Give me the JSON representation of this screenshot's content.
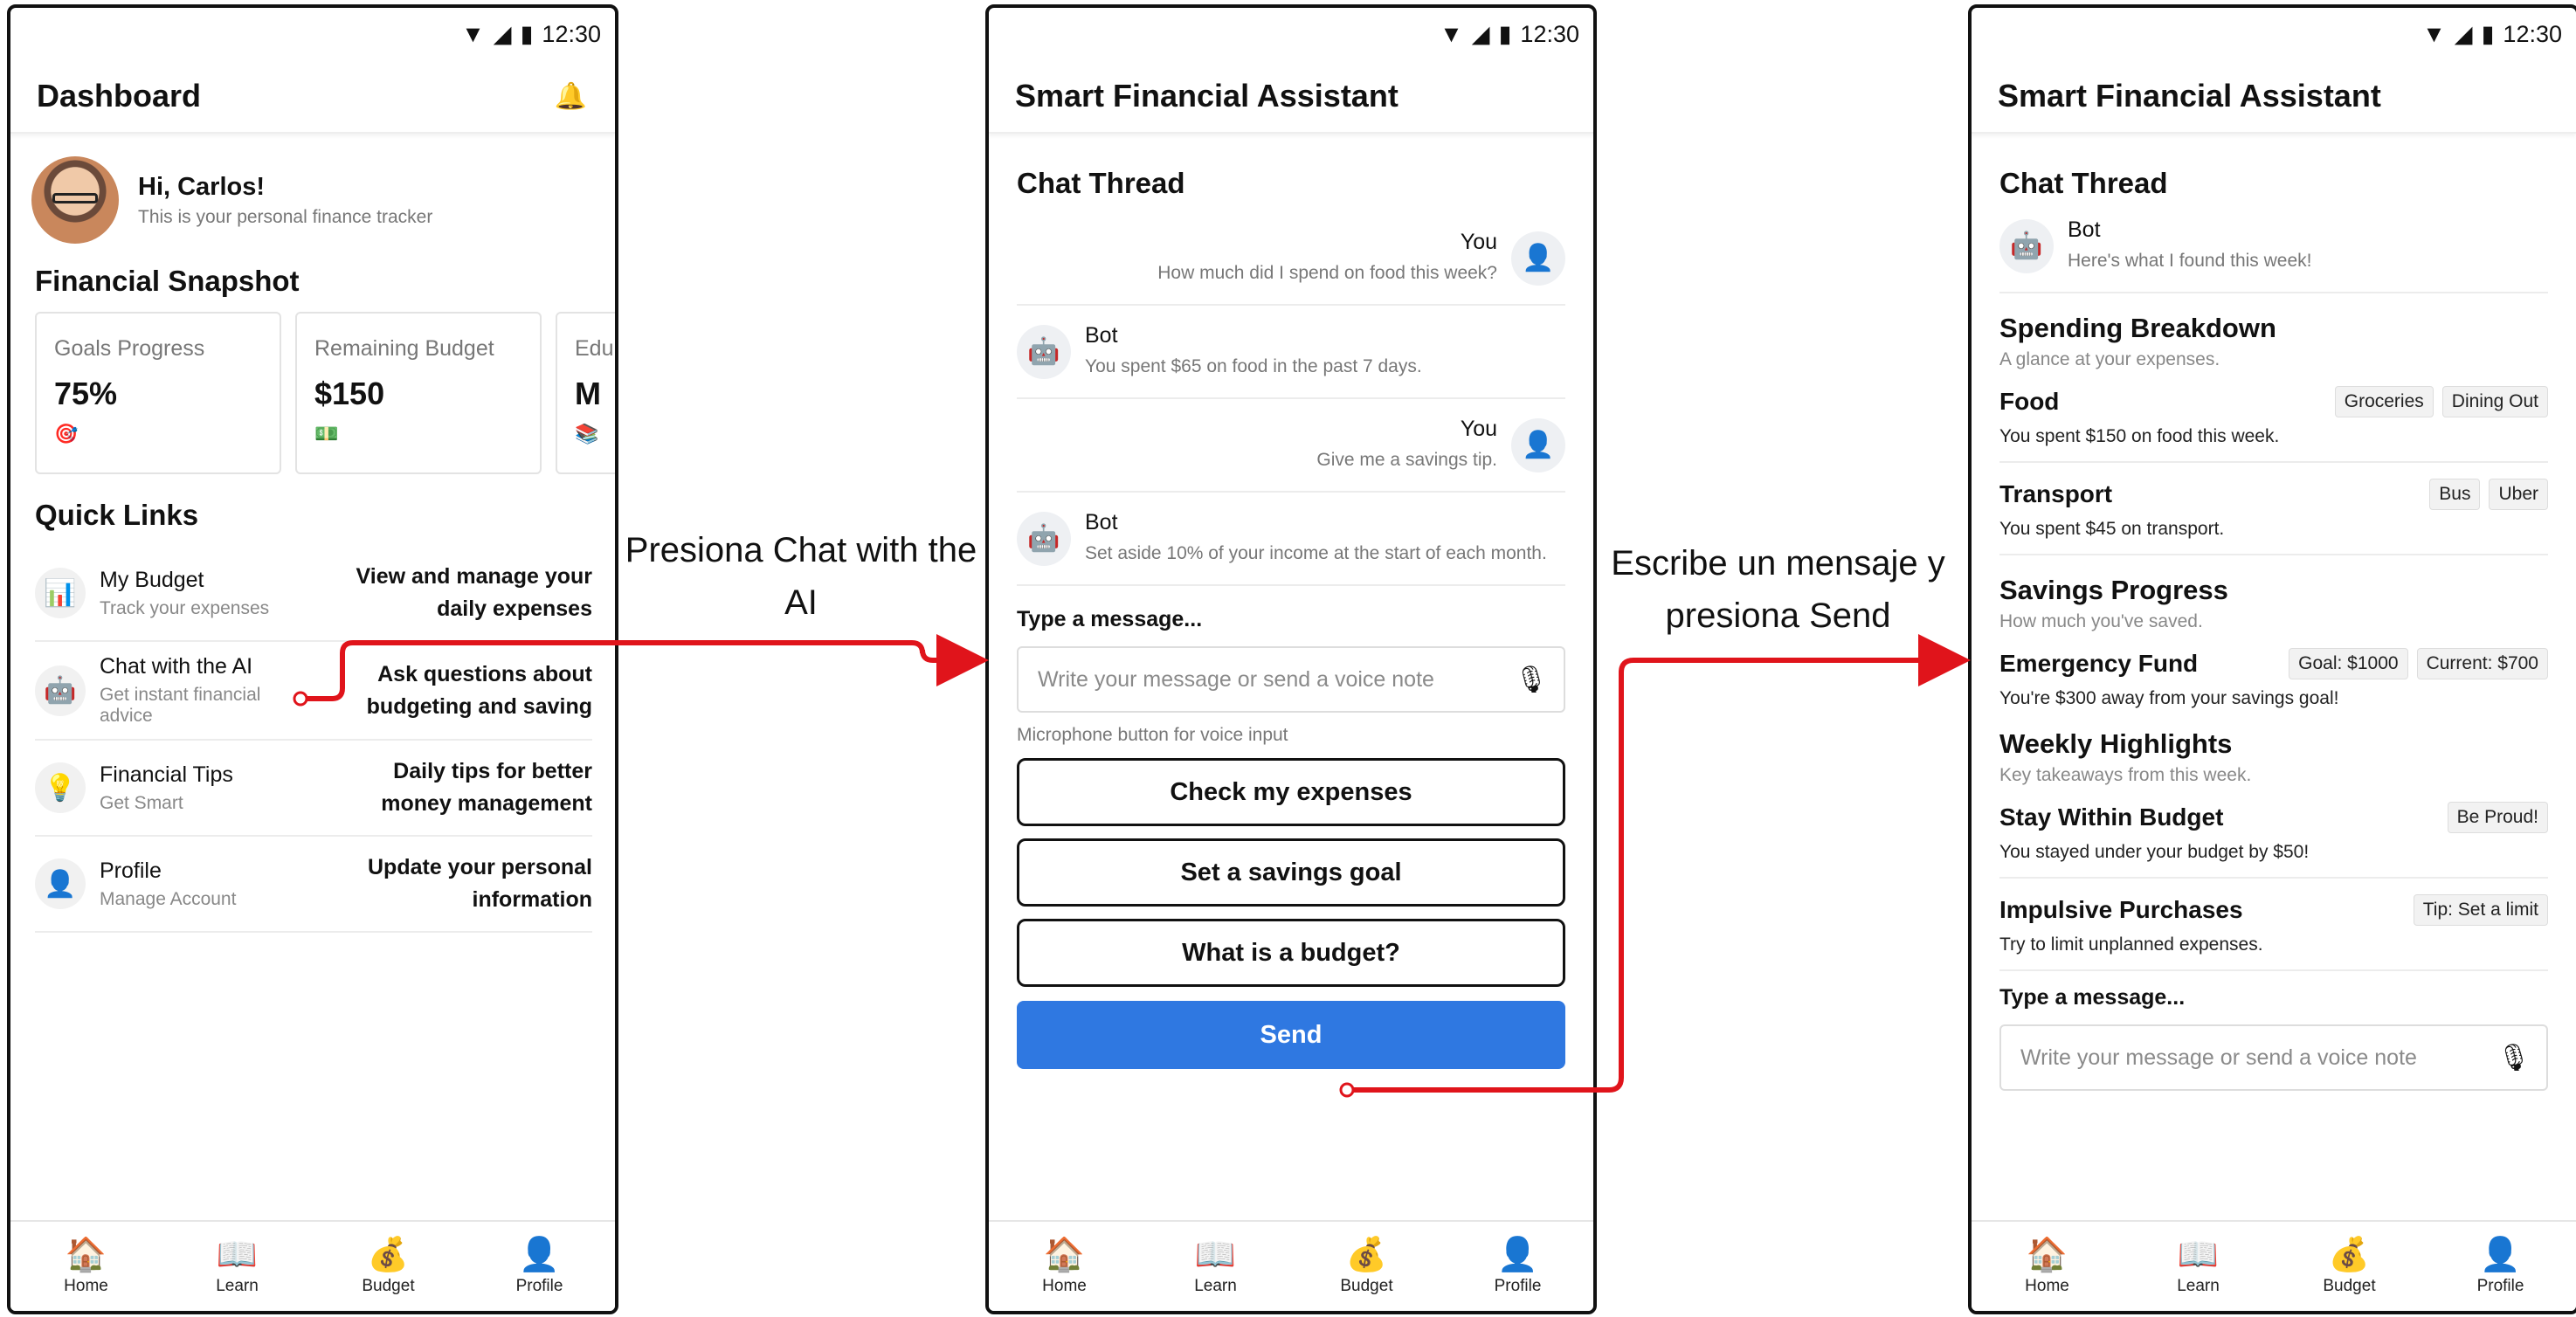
{
  "status_bar": {
    "time": "12:30"
  },
  "screen1": {
    "title": "Dashboard",
    "greeting": "Hi, Carlos!",
    "greeting_sub": "This is your personal finance tracker",
    "snapshot_title": "Financial Snapshot",
    "cards": [
      {
        "label": "Goals Progress",
        "value": "75%",
        "icon": "🎯"
      },
      {
        "label": "Remaining Budget",
        "value": "$150",
        "icon": "💵"
      },
      {
        "label": "Edu",
        "value": "M",
        "icon": "📚"
      }
    ],
    "quick_links_title": "Quick Links",
    "quick_links": [
      {
        "icon": "📊",
        "name": "My Budget",
        "sub": "Track your expenses",
        "desc": "View and manage your daily expenses"
      },
      {
        "icon": "🤖",
        "name": "Chat with the AI",
        "sub": "Get instant financial advice",
        "desc": "Ask questions about budgeting and saving"
      },
      {
        "icon": "💡",
        "name": "Financial Tips",
        "sub": "Get Smart",
        "desc": "Daily tips for better money management"
      },
      {
        "icon": "👤",
        "name": "Profile",
        "sub": "Manage Account",
        "desc": "Update your personal information"
      }
    ]
  },
  "screen2": {
    "title": "Smart Financial Assistant",
    "thread_title": "Chat Thread",
    "messages": [
      {
        "who": "You",
        "text": "How much did I spend on food this week?"
      },
      {
        "who": "Bot",
        "text": "You spent $65 on food in the past 7 days."
      },
      {
        "who": "You",
        "text": "Give me a savings tip."
      },
      {
        "who": "Bot",
        "text": "Set aside 10% of your income at the start of each month."
      }
    ],
    "type_label": "Type a message...",
    "input_placeholder": "Write your message or send a voice note",
    "mic_hint": "Microphone button for voice input",
    "quick_replies": [
      "Check my expenses",
      "Set a savings goal",
      "What is a budget?"
    ],
    "send_label": "Send"
  },
  "screen3": {
    "title": "Smart Financial Assistant",
    "thread_title": "Chat Thread",
    "bot_who": "Bot",
    "bot_text": "Here's what I found this week!",
    "spending_title": "Spending Breakdown",
    "spending_sub": "A glance at your expenses.",
    "food_name": "Food",
    "food_tags": [
      "Groceries",
      "Dining Out"
    ],
    "food_text": "You spent $150 on food this week.",
    "transport_name": "Transport",
    "transport_tags": [
      "Bus",
      "Uber"
    ],
    "transport_text": "You spent $45 on transport.",
    "savings_title": "Savings Progress",
    "savings_sub": "How much you've saved.",
    "emergency_name": "Emergency Fund",
    "emergency_tags": [
      "Goal: $1000",
      "Current: $700"
    ],
    "emergency_text": "You're $300 away from your savings goal!",
    "weekly_title": "Weekly Highlights",
    "weekly_sub": "Key takeaways from this week.",
    "stay_name": "Stay Within Budget",
    "stay_tag": "Be Proud!",
    "stay_text": "You stayed under your budget by $50!",
    "impulse_name": "Impulsive Purchases",
    "impulse_tag": "Tip: Set a limit",
    "impulse_text": "Try to limit unplanned expenses.",
    "type_label": "Type a message...",
    "input_placeholder": "Write your message or send a voice note"
  },
  "nav": [
    {
      "icon": "🏠",
      "label": "Home"
    },
    {
      "icon": "📖",
      "label": "Learn"
    },
    {
      "icon": "💰",
      "label": "Budget"
    },
    {
      "icon": "👤",
      "label": "Profile"
    }
  ],
  "annotations": {
    "step1": "Presiona Chat with the AI",
    "step2": "Escribe un mensaje y presiona Send"
  },
  "colors": {
    "send_button": "#2f78e1",
    "arrow": "#e0141b"
  }
}
